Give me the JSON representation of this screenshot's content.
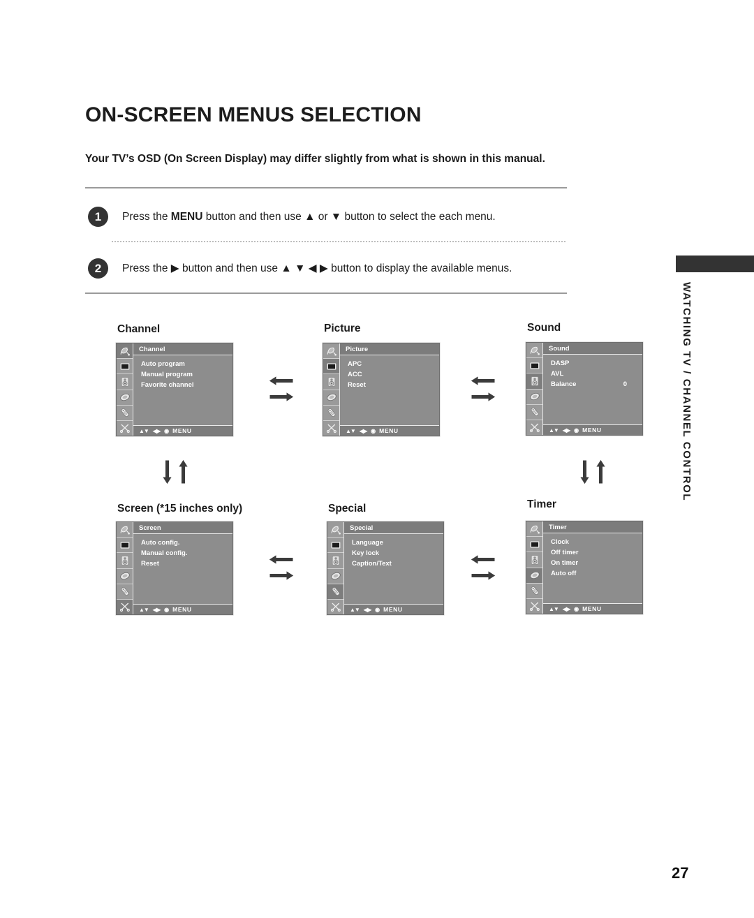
{
  "page": {
    "title": "ON-SCREEN MENUS SELECTION",
    "intro": "Your TV’s OSD (On Screen Display) may differ slightly from what is shown in this manual.",
    "number": "27",
    "side_tab": "WATCHING TV / CHANNEL CONTROL"
  },
  "steps": [
    {
      "badge": "1",
      "pre": "Press the ",
      "bold": "MENU",
      "post": " button and then use ▲ or ▼ button to select the each menu."
    },
    {
      "badge": "2",
      "pre": "Press the ▶ button and then use ▲ ▼ ◀ ▶ button to display the available menus.",
      "bold": "",
      "post": ""
    }
  ],
  "osd_nav": {
    "updown": "▲▼",
    "leftright": "◀▶",
    "select": "◉",
    "menu": "MENU"
  },
  "rail_icons": [
    "satellite-dish-icon",
    "tv-screen-icon",
    "speaker-icon",
    "oval-timer-icon",
    "remote-control-icon",
    "scissors-tools-icon"
  ],
  "menus": [
    {
      "caption": "Channel",
      "header": "Channel",
      "active_index": 0,
      "items": [
        {
          "label": "Auto program",
          "value": ""
        },
        {
          "label": "Manual program",
          "value": ""
        },
        {
          "label": "Favorite channel",
          "value": ""
        }
      ]
    },
    {
      "caption": "Picture",
      "header": "Picture",
      "active_index": 1,
      "items": [
        {
          "label": "APC",
          "value": ""
        },
        {
          "label": "ACC",
          "value": ""
        },
        {
          "label": "Reset",
          "value": ""
        }
      ]
    },
    {
      "caption": "Sound",
      "header": "Sound",
      "active_index": 2,
      "items": [
        {
          "label": "DASP",
          "value": ""
        },
        {
          "label": "AVL",
          "value": ""
        },
        {
          "label": "Balance",
          "value": "0"
        }
      ]
    },
    {
      "caption": "Screen (*15 inches only)",
      "header": "Screen",
      "active_index": 5,
      "items": [
        {
          "label": "Auto config.",
          "value": ""
        },
        {
          "label": "Manual config.",
          "value": ""
        },
        {
          "label": "Reset",
          "value": ""
        }
      ]
    },
    {
      "caption": "Special",
      "header": "Special",
      "active_index": 4,
      "items": [
        {
          "label": "Language",
          "value": ""
        },
        {
          "label": "Key lock",
          "value": ""
        },
        {
          "label": "Caption/Text",
          "value": ""
        }
      ]
    },
    {
      "caption": "Timer",
      "header": "Timer",
      "active_index": 3,
      "items": [
        {
          "label": "Clock",
          "value": ""
        },
        {
          "label": "Off timer",
          "value": ""
        },
        {
          "label": "On timer",
          "value": ""
        },
        {
          "label": "Auto off",
          "value": ""
        }
      ]
    }
  ],
  "flow_arrows": [
    {
      "name": "flow-arrow-channel-to-picture",
      "orientation": "horizontal"
    },
    {
      "name": "flow-arrow-picture-to-sound",
      "orientation": "horizontal"
    },
    {
      "name": "flow-arrow-channel-to-screen",
      "orientation": "vertical"
    },
    {
      "name": "flow-arrow-sound-to-timer",
      "orientation": "vertical"
    },
    {
      "name": "flow-arrow-screen-to-special",
      "orientation": "horizontal"
    },
    {
      "name": "flow-arrow-special-to-timer",
      "orientation": "horizontal"
    }
  ],
  "colors": {
    "osd_body": "#8d8d8d",
    "osd_header": "#7c7c7c",
    "osd_rail": "#9a9a9a",
    "osd_rail_active": "#7d7d7d",
    "badge": "#333333",
    "side_tab": "#333333"
  }
}
